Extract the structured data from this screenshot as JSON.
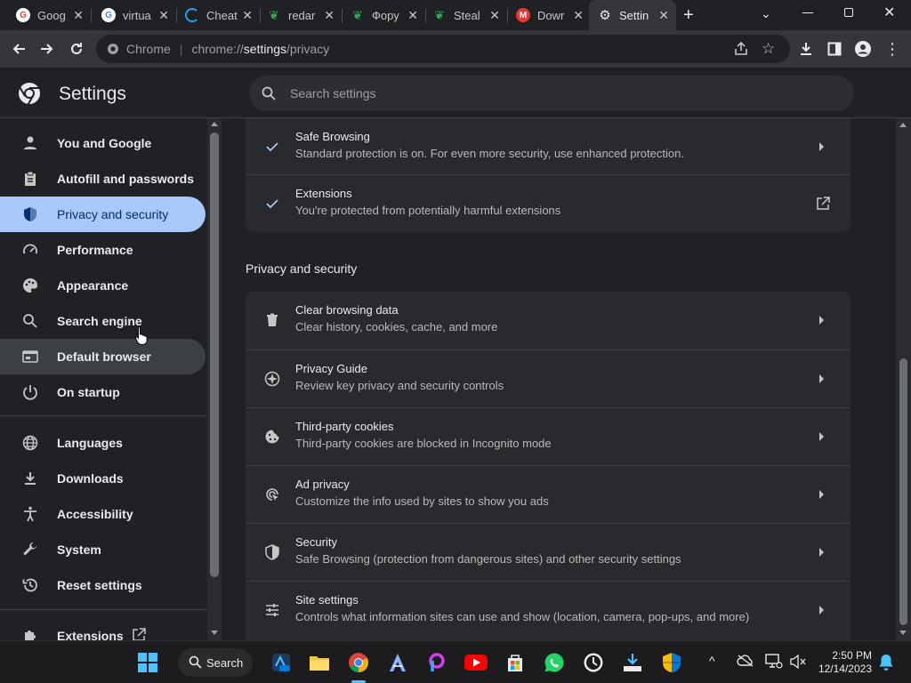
{
  "tabs": [
    {
      "title": "Goog",
      "favicon": "G",
      "favicon_color": "#ea4335"
    },
    {
      "title": "virtua",
      "favicon": "G",
      "favicon_color": "#4285f4"
    },
    {
      "title": "Cheat",
      "favicon": "C",
      "favicon_color": "#1da1f2"
    },
    {
      "title": "redar",
      "favicon": "r",
      "favicon_color": "#34a853"
    },
    {
      "title": "Фору",
      "favicon": "r",
      "favicon_color": "#34a853"
    },
    {
      "title": "Steal",
      "favicon": "r",
      "favicon_color": "#34a853"
    },
    {
      "title": "Dowr",
      "favicon": "M",
      "favicon_color": "#e53935"
    },
    {
      "title": "Settin",
      "favicon": "⚙",
      "favicon_color": "#e8eaed"
    }
  ],
  "toolbar": {
    "chip": "Chrome",
    "url_prefix": "chrome://",
    "url_host": "settings",
    "url_path": "/privacy"
  },
  "header": {
    "title": "Settings",
    "search_placeholder": "Search settings"
  },
  "sidebar": {
    "items": [
      {
        "label": "You and Google",
        "icon": "person-icon"
      },
      {
        "label": "Autofill and passwords",
        "icon": "clipboard-icon"
      },
      {
        "label": "Privacy and security",
        "icon": "shield-icon"
      },
      {
        "label": "Performance",
        "icon": "speedometer-icon"
      },
      {
        "label": "Appearance",
        "icon": "palette-icon"
      },
      {
        "label": "Search engine",
        "icon": "search-icon"
      },
      {
        "label": "Default browser",
        "icon": "browser-icon"
      },
      {
        "label": "On startup",
        "icon": "power-icon"
      },
      {
        "label": "Languages",
        "icon": "globe-icon"
      },
      {
        "label": "Downloads",
        "icon": "download-icon"
      },
      {
        "label": "Accessibility",
        "icon": "accessibility-icon"
      },
      {
        "label": "System",
        "icon": "wrench-icon"
      },
      {
        "label": "Reset settings",
        "icon": "history-icon"
      },
      {
        "label": "Extensions",
        "icon": "puzzle-icon"
      }
    ]
  },
  "main": {
    "top_card": [
      {
        "title": "Safe Browsing",
        "subtitle": "Standard protection is on. For even more security, use enhanced protection."
      },
      {
        "title": "Extensions",
        "subtitle": "You're protected from potentially harmful extensions"
      }
    ],
    "section_title": "Privacy and security",
    "rows": [
      {
        "title": "Clear browsing data",
        "subtitle": "Clear history, cookies, cache, and more"
      },
      {
        "title": "Privacy Guide",
        "subtitle": "Review key privacy and security controls"
      },
      {
        "title": "Third-party cookies",
        "subtitle": "Third-party cookies are blocked in Incognito mode"
      },
      {
        "title": "Ad privacy",
        "subtitle": "Customize the info used by sites to show you ads"
      },
      {
        "title": "Security",
        "subtitle": "Safe Browsing (protection from dangerous sites) and other security settings"
      },
      {
        "title": "Site settings",
        "subtitle": "Controls what information sites can use and show (location, camera, pop-ups, and more)"
      }
    ]
  },
  "taskbar": {
    "search_label": "Search",
    "time": "2:50 PM",
    "date": "12/14/2023"
  },
  "colors": {
    "selected_nav": "#a8c7fa",
    "card": "#292a2d",
    "background": "#202124"
  }
}
